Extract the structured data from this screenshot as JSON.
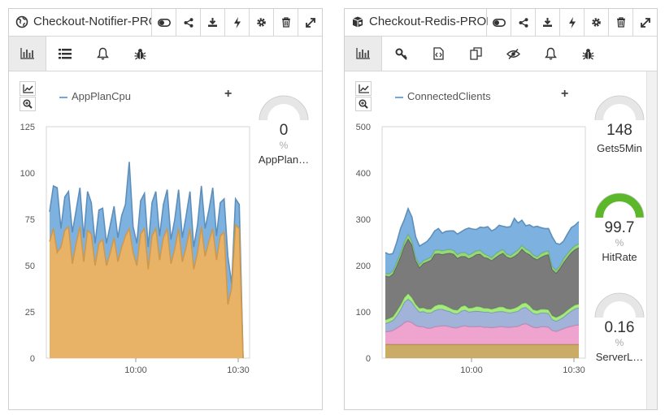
{
  "panels": [
    {
      "title": "Checkout-Notifier-PROD",
      "title_icon": "globe-icon",
      "legend": "AppPlanCpu",
      "add_symbol": "+",
      "gauges": [
        {
          "value": "0",
          "unit": "%",
          "label": "AppPlan…",
          "fill": 0,
          "color": "#e8e8e8"
        }
      ],
      "chart_data": {
        "type": "area",
        "series": [
          {
            "name": "AppPlanCpu",
            "color": "#6fa8dc",
            "values": [
              79,
              93,
              92,
              70,
              87,
              90,
              68,
              80,
              92,
              65,
              90,
              84,
              62,
              80,
              81,
              62,
              72,
              82,
              65,
              77,
              83,
              106,
              71,
              62,
              85,
              89,
              60,
              84,
              90,
              66,
              83,
              91,
              64,
              75,
              91,
              65,
              77,
              90,
              60,
              72,
              93,
              70,
              80,
              92,
              66,
              84,
              86,
              55,
              40,
              86,
              83,
              0
            ]
          },
          {
            "name": "",
            "color": "#f4b459",
            "values": [
              63,
              70,
              57,
              60,
              69,
              71,
              51,
              62,
              71,
              52,
              69,
              67,
              50,
              62,
              64,
              50,
              57,
              65,
              52,
              60,
              66,
              70,
              57,
              50,
              67,
              70,
              48,
              66,
              70,
              53,
              65,
              70,
              51,
              59,
              70,
              52,
              60,
              70,
              48,
              57,
              71,
              55,
              63,
              70,
              53,
              66,
              68,
              29,
              38,
              72,
              70,
              0
            ]
          }
        ],
        "x_ticks": [
          "10:00",
          "10:30"
        ],
        "y_ticks": [
          0,
          25,
          50,
          75,
          100,
          125
        ],
        "ylim": [
          0,
          125
        ]
      }
    },
    {
      "title": "Checkout-Redis-PROD",
      "title_icon": "database-icon",
      "legend": "ConnectedClients",
      "add_symbol": "+",
      "gauges": [
        {
          "value": "148",
          "unit": "",
          "label": "Gets5Min",
          "fill": 0,
          "color": "#e8e8e8"
        },
        {
          "value": "99.7",
          "unit": "%",
          "label": "HitRate",
          "fill": 0.997,
          "color": "#5cb82a"
        },
        {
          "value": "0.16",
          "unit": "%",
          "label": "ServerL…",
          "fill": 0.0016,
          "color": "#e8e8e8"
        }
      ],
      "chart_data": {
        "type": "area",
        "stacked": true,
        "series": [
          {
            "name": "",
            "color": "#c5a356",
            "values": [
              30,
              30,
              30,
              30,
              30,
              30,
              30,
              30,
              30,
              30,
              30,
              30,
              30,
              30,
              30,
              30,
              30,
              30,
              30,
              30,
              30,
              30,
              30,
              30,
              30,
              30,
              30,
              30,
              30,
              30,
              30,
              30,
              30,
              30,
              30,
              30,
              30,
              30,
              30,
              30,
              30,
              30,
              30,
              30,
              30,
              30,
              30,
              30,
              30,
              30,
              30,
              30
            ]
          },
          {
            "name": "",
            "color": "#ec9ac9",
            "values": [
              27,
              28,
              30,
              35,
              40,
              47,
              50,
              47,
              41,
              38,
              38,
              35,
              35,
              38,
              39,
              40,
              40,
              38,
              36,
              36,
              39,
              40,
              38,
              38,
              38,
              39,
              37,
              37,
              36,
              37,
              38,
              38,
              37,
              37,
              38,
              39,
              43,
              45,
              41,
              37,
              36,
              38,
              38,
              37,
              30,
              28,
              31,
              34,
              37,
              39,
              41,
              42
            ]
          },
          {
            "name": "",
            "color": "#97abd4",
            "values": [
              18,
              20,
              22,
              27,
              35,
              44,
              48,
              44,
              38,
              32,
              33,
              33,
              33,
              35,
              37,
              36,
              33,
              33,
              31,
              30,
              33,
              34,
              32,
              33,
              34,
              32,
              33,
              33,
              32,
              33,
              33,
              33,
              32,
              31,
              32,
              33,
              35,
              35,
              33,
              30,
              29,
              30,
              30,
              30,
              24,
              22,
              23,
              25,
              29,
              33,
              36,
              37
            ]
          },
          {
            "name": "",
            "color": "#9bea70",
            "values": [
              8,
              8,
              8,
              10,
              10,
              10,
              12,
              10,
              8,
              8,
              8,
              8,
              8,
              10,
              10,
              10,
              10,
              8,
              8,
              8,
              10,
              10,
              8,
              8,
              10,
              10,
              8,
              8,
              8,
              8,
              10,
              10,
              8,
              8,
              8,
              10,
              10,
              10,
              10,
              8,
              8,
              8,
              8,
              8,
              8,
              8,
              8,
              8,
              8,
              8,
              8,
              8
            ]
          },
          {
            "name": "",
            "color": "#6d6d6d",
            "values": [
              95,
              90,
              92,
              98,
              105,
              112,
              118,
              114,
              95,
              88,
              96,
              102,
              106,
              112,
              110,
              108,
              113,
              118,
              120,
              112,
              108,
              106,
              107,
              110,
              112,
              114,
              110,
              108,
              105,
              109,
              112,
              116,
              112,
              110,
              112,
              114,
              118,
              108,
              110,
              112,
              110,
              112,
              116,
              119,
              100,
              96,
              102,
              110,
              114,
              118,
              120,
              122
            ]
          },
          {
            "name": "",
            "color": "#8bd66b",
            "values": [
              5,
              6,
              6,
              8,
              8,
              8,
              10,
              8,
              6,
              6,
              6,
              6,
              6,
              8,
              8,
              8,
              8,
              8,
              8,
              8,
              8,
              8,
              8,
              8,
              8,
              8,
              8,
              6,
              6,
              8,
              8,
              8,
              6,
              6,
              8,
              8,
              8,
              8,
              8,
              6,
              6,
              8,
              8,
              8,
              6,
              6,
              6,
              8,
              8,
              8,
              8,
              8
            ]
          },
          {
            "name": "",
            "color": "#6fa8dc",
            "values": [
              45,
              42,
              38,
              42,
              52,
              48,
              55,
              52,
              44,
              40,
              36,
              38,
              44,
              42,
              46,
              38,
              40,
              40,
              42,
              44,
              45,
              50,
              58,
              52,
              46,
              50,
              56,
              62,
              58,
              54,
              56,
              50,
              58,
              62,
              74,
              58,
              54,
              50,
              56,
              60,
              66,
              56,
              50,
              48,
              64,
              58,
              46,
              38,
              42,
              46,
              44,
              48
            ]
          }
        ],
        "x_ticks": [
          "10:00",
          "10:30"
        ],
        "y_ticks": [
          0,
          100,
          200,
          300,
          400,
          500
        ],
        "ylim": [
          0,
          500
        ]
      }
    }
  ]
}
